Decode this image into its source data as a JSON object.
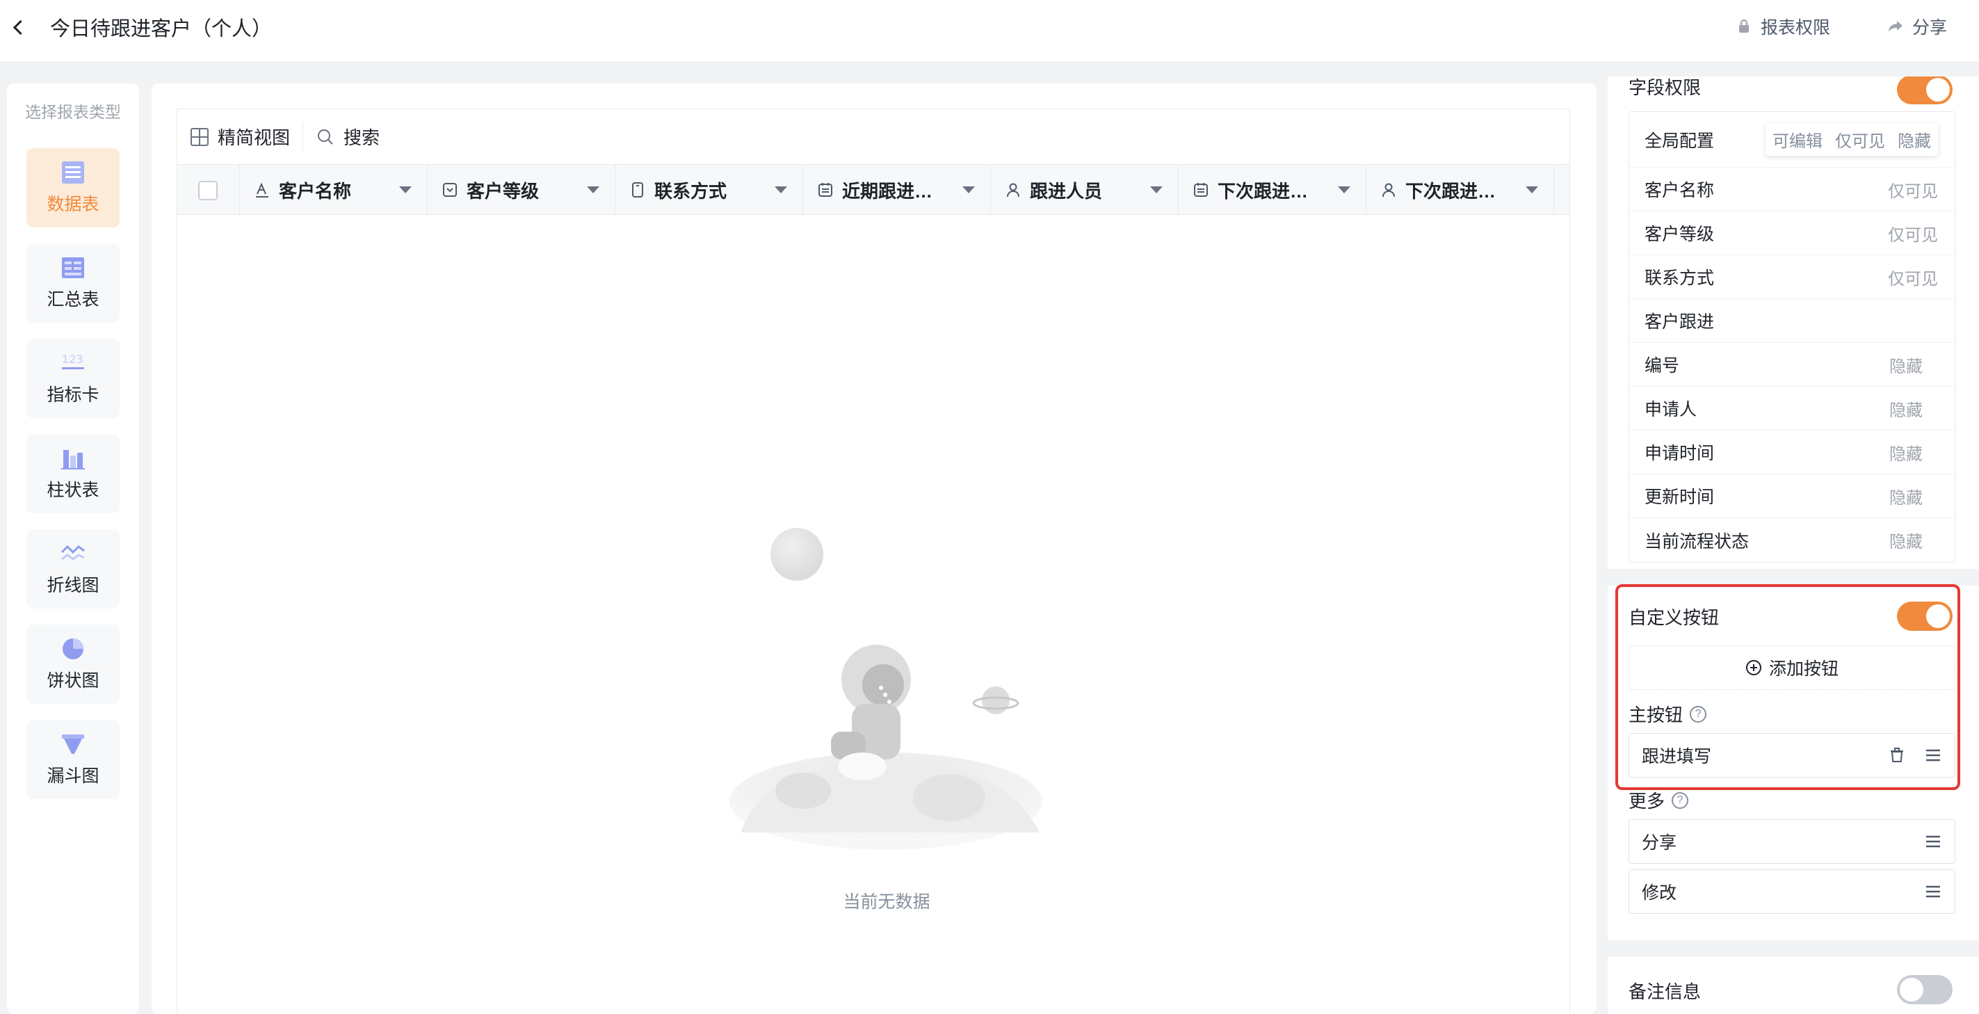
{
  "header": {
    "title": "今日待跟进客户（个人）",
    "report_permission": "报表权限",
    "share": "分享"
  },
  "rail": {
    "title": "选择报表类型",
    "items": [
      {
        "label": "数据表",
        "icon": "table-icon",
        "active": true
      },
      {
        "label": "汇总表",
        "icon": "summary-table-icon"
      },
      {
        "label": "指标卡",
        "icon": "metric-card-icon"
      },
      {
        "label": "柱状表",
        "icon": "bar-chart-icon"
      },
      {
        "label": "折线图",
        "icon": "line-chart-icon"
      },
      {
        "label": "饼状图",
        "icon": "pie-chart-icon"
      },
      {
        "label": "漏斗图",
        "icon": "funnel-chart-icon"
      }
    ]
  },
  "toolbar": {
    "simple_view": "精简视图",
    "search": "搜索"
  },
  "columns": [
    {
      "label": "客户名称",
      "icon": "text-field-icon"
    },
    {
      "label": "客户等级",
      "icon": "select-field-icon"
    },
    {
      "label": "联系方式",
      "icon": "phone-field-icon"
    },
    {
      "label": "近期跟进…",
      "icon": "date-field-icon"
    },
    {
      "label": "跟进人员",
      "icon": "user-field-icon"
    },
    {
      "label": "下次跟进…",
      "icon": "date-field-icon"
    },
    {
      "label": "下次跟进…",
      "icon": "user-field-icon"
    }
  ],
  "empty_text": "当前无数据",
  "panel": {
    "field_permission_title": "字段权限",
    "global_config": {
      "label": "全局配置",
      "options": [
        "可编辑",
        "仅可见",
        "隐藏"
      ]
    },
    "fields": [
      {
        "name": "客户名称",
        "perm": "仅可见"
      },
      {
        "name": "客户等级",
        "perm": "仅可见"
      },
      {
        "name": "联系方式",
        "perm": "仅可见"
      },
      {
        "name": "客户跟进",
        "perm": ""
      },
      {
        "name": "编号",
        "perm": "隐藏"
      },
      {
        "name": "申请人",
        "perm": "隐藏"
      },
      {
        "name": "申请时间",
        "perm": "隐藏"
      },
      {
        "name": "更新时间",
        "perm": "隐藏"
      },
      {
        "name": "当前流程状态",
        "perm": "隐藏"
      }
    ],
    "custom_buttons": {
      "label": "自定义按钮",
      "enabled": true,
      "add_button": "添加按钮",
      "primary_label": "主按钮",
      "primary_button": "跟进填写",
      "more_label": "更多",
      "more_buttons": [
        "分享",
        "修改"
      ]
    },
    "notes": {
      "label": "备注信息",
      "enabled": false
    }
  },
  "colors": {
    "accent": "#f08a3c",
    "highlight": "#e53935"
  }
}
